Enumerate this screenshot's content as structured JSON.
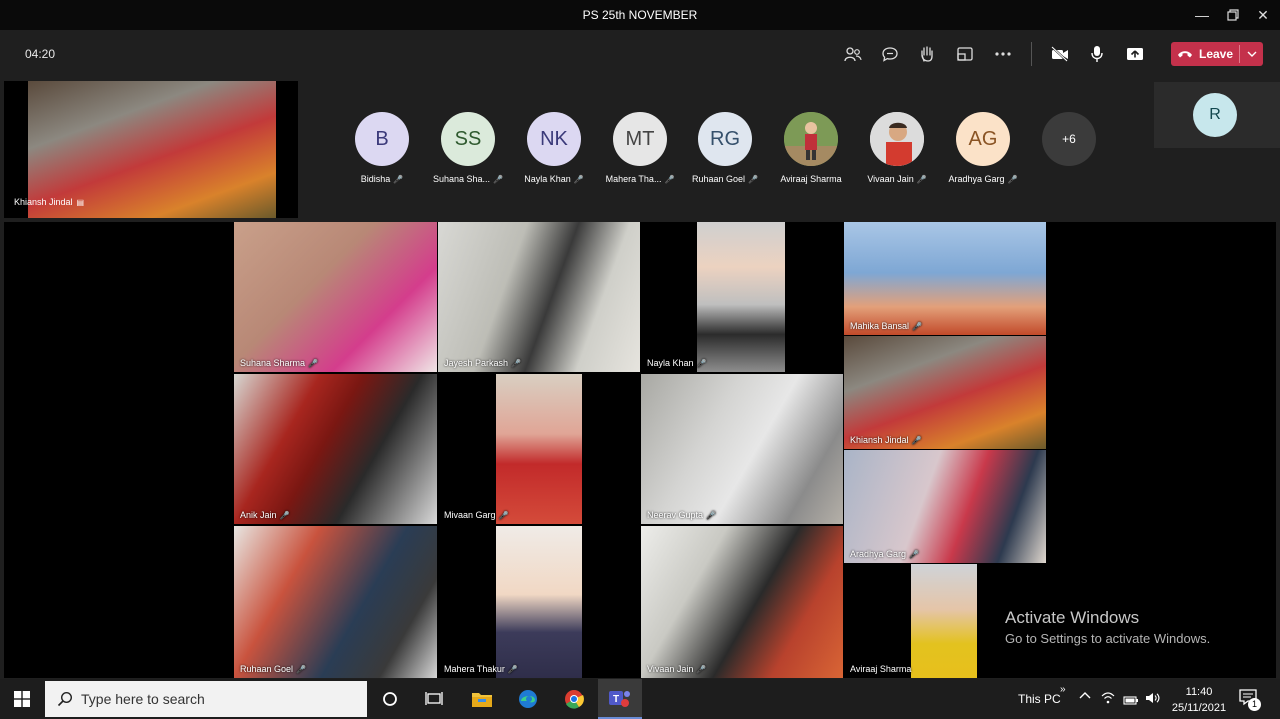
{
  "window": {
    "title": "PS 25th NOVEMBER"
  },
  "meeting": {
    "timer": "04:20",
    "leave_label": "Leave"
  },
  "self_view": {
    "name": "Khiansh Jindal"
  },
  "participants_strip": [
    {
      "initials": "B",
      "name": "Bidisha",
      "bg": "#dcd8f2",
      "fg": "#3b3a7a"
    },
    {
      "initials": "SS",
      "name": "Suhana Sha...",
      "bg": "#dbeadb",
      "fg": "#2f5a2f"
    },
    {
      "initials": "NK",
      "name": "Nayla Khan",
      "bg": "#dcd8f2",
      "fg": "#3b3a7a"
    },
    {
      "initials": "MT",
      "name": "Mahera Tha...",
      "bg": "#e6e6e6",
      "fg": "#444444"
    },
    {
      "initials": "RG",
      "name": "Ruhaan Goel",
      "bg": "#dfe6ef",
      "fg": "#35506b"
    },
    {
      "initials": "",
      "name": "Aviraaj Sharma",
      "bg": "#6f8a4a",
      "fg": "#ffffff"
    },
    {
      "initials": "",
      "name": "Vivaan Jain",
      "bg": "#d9d9d9",
      "fg": "#ffffff"
    },
    {
      "initials": "AG",
      "name": "Aradhya Garg",
      "bg": "#fbe2c8",
      "fg": "#8a5424"
    }
  ],
  "overflow_count": "+6",
  "right_panel": {
    "initials": "R"
  },
  "tiles": [
    {
      "name": "Suhana  Sharma"
    },
    {
      "name": "Jayesh  Parkash"
    },
    {
      "name": "Nayla Khan"
    },
    {
      "name": "Mahika Bansal"
    },
    {
      "name": "Anik  Jain"
    },
    {
      "name": "Mivaan  Garg"
    },
    {
      "name": "Neerav  Gupta"
    },
    {
      "name": "Khiansh  Jindal"
    },
    {
      "name": "Aradhya Garg"
    },
    {
      "name": "Ruhaan  Goel"
    },
    {
      "name": "Mahera  Thakur"
    },
    {
      "name": "Vivaan Jain"
    },
    {
      "name": "Aviraaj Sharma"
    }
  ],
  "watermark": {
    "line1": "Activate Windows",
    "line2": "Go to Settings to activate Windows."
  },
  "taskbar": {
    "search_placeholder": "Type here to search",
    "this_pc": "This PC",
    "time": "11:40",
    "date": "25/11/2021",
    "notification_count": "1"
  }
}
